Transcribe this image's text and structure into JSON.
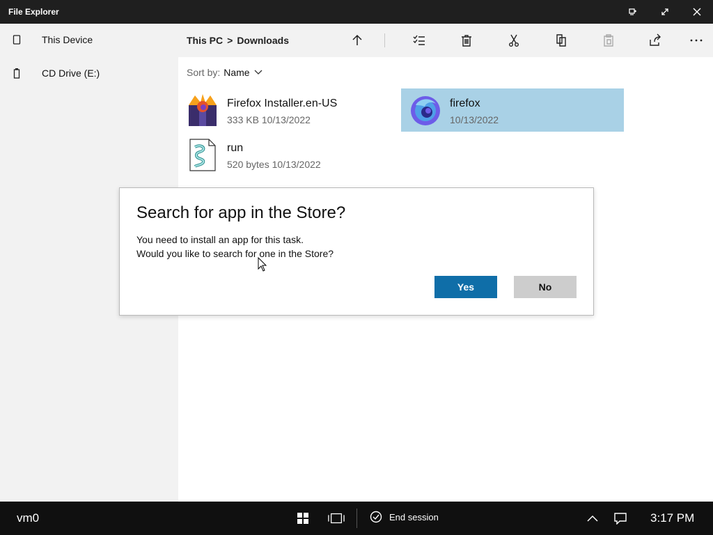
{
  "window": {
    "title": "File Explorer"
  },
  "sidebar": {
    "items": [
      {
        "label": "This Device",
        "icon": "device-icon"
      },
      {
        "label": "CD Drive (E:)",
        "icon": "drive-icon"
      }
    ]
  },
  "breadcrumb": {
    "parts": [
      "This PC",
      ">",
      "Downloads"
    ]
  },
  "toolbar": {
    "icons": [
      "up-arrow-icon",
      "select-icon",
      "delete-icon",
      "cut-icon",
      "copy-icon",
      "paste-icon",
      "share-icon",
      "more-icon"
    ]
  },
  "sort": {
    "label": "Sort by:",
    "value": "Name"
  },
  "files": [
    {
      "name": "Firefox Installer.en-US",
      "size": "333 KB",
      "date": "10/13/2022",
      "icon": "installer-icon",
      "selected": false
    },
    {
      "name": "firefox",
      "size": "",
      "date": "10/13/2022",
      "icon": "firefox-icon",
      "selected": true
    },
    {
      "name": "run",
      "size": "520 bytes",
      "date": "10/13/2022",
      "icon": "script-icon",
      "selected": false
    }
  ],
  "dialog": {
    "title": "Search for app in the Store?",
    "message_line1": "You need to install an app for this task.",
    "message_line2": "Would you like to search for one in the Store?",
    "yes_label": "Yes",
    "no_label": "No"
  },
  "taskbar": {
    "host": "vm0",
    "end_session_label": "End session",
    "time": "3:17 PM"
  },
  "colors": {
    "selection": "#a9d1e6",
    "primary_button": "#0f6ea8",
    "titlebar": "#1f1f1f",
    "taskbar": "#101010"
  }
}
